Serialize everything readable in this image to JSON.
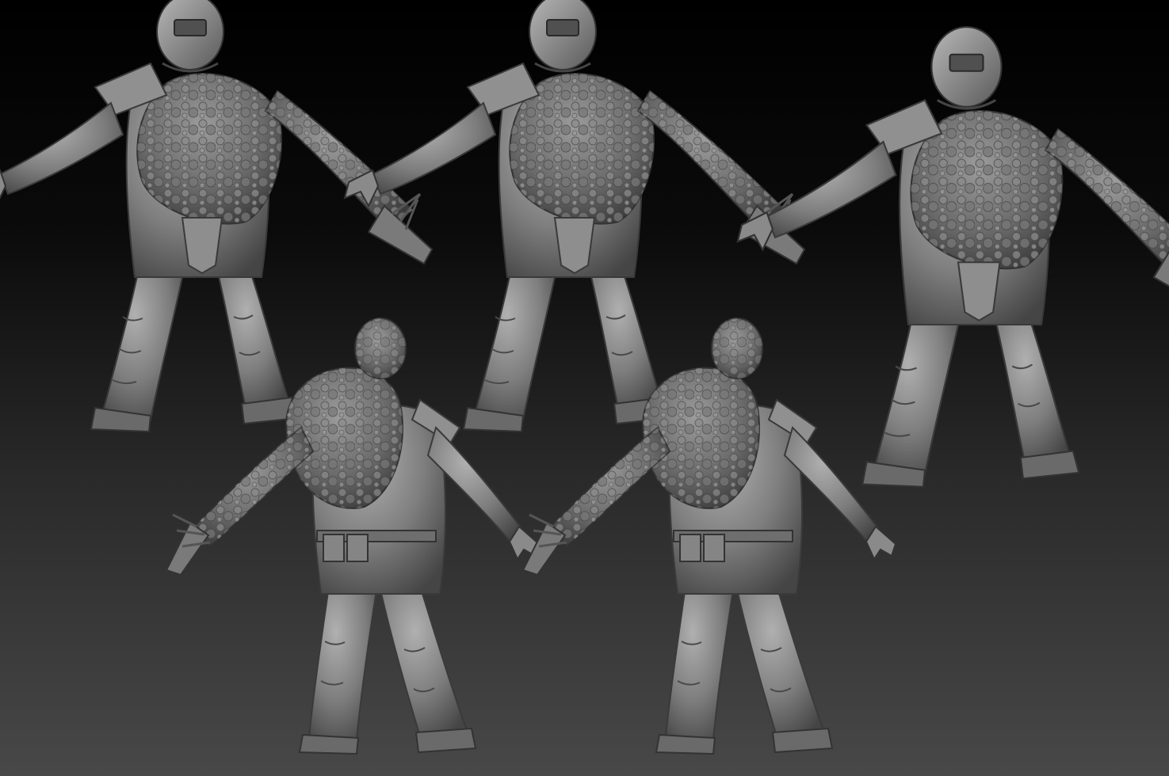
{
  "scene": {
    "background_top": "#000000",
    "background_bottom": "#484848",
    "clay_light": "#a6a6a6",
    "clay_mid": "#7e7e7e",
    "clay_dark": "#4a4a4a",
    "views": [
      {
        "id": "front-left",
        "facing": "front",
        "mirrored": false
      },
      {
        "id": "front-center",
        "facing": "front",
        "mirrored": false
      },
      {
        "id": "front-right",
        "facing": "three-quarter",
        "mirrored": false
      },
      {
        "id": "back-left",
        "facing": "back",
        "mirrored": false
      },
      {
        "id": "back-right",
        "facing": "back",
        "mirrored": false
      }
    ]
  }
}
